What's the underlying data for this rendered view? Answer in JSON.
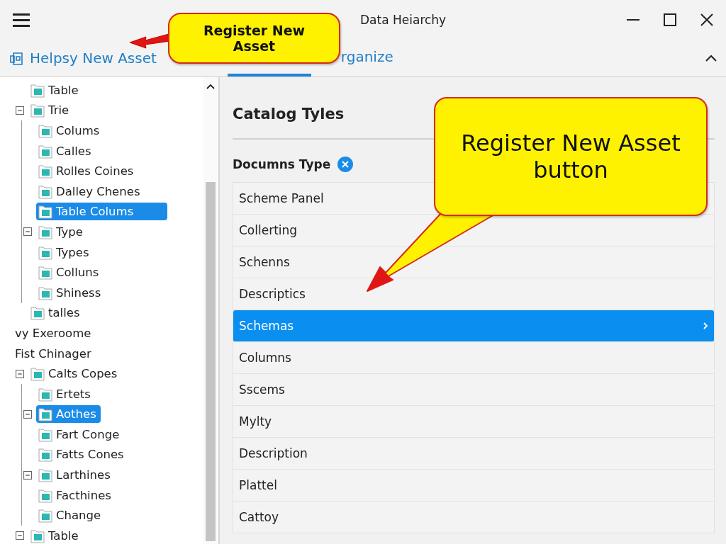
{
  "window": {
    "title": "Data Heiarchy"
  },
  "toolbar": {
    "action": "Helpsy New Asset",
    "tabs": [
      {
        "selected": true
      },
      {
        "label": "rganize",
        "selected": false
      }
    ]
  },
  "tree": [
    {
      "label": "Table",
      "kind": "folder",
      "expandable": false,
      "selected": false
    },
    {
      "label": "Trie",
      "kind": "folder",
      "expandable": true,
      "selected": false,
      "children": [
        {
          "label": "Colums",
          "kind": "folder",
          "expandable": false,
          "selected": false
        },
        {
          "label": "Calles",
          "kind": "folder",
          "expandable": false,
          "selected": false
        },
        {
          "label": "Rolles Coines",
          "kind": "folder",
          "expandable": false,
          "selected": false
        },
        {
          "label": "Dalley Chenes",
          "kind": "folder",
          "expandable": false,
          "selected": false
        },
        {
          "label": "Table Colums",
          "kind": "folder",
          "expandable": false,
          "selected": true
        },
        {
          "label": "Type",
          "kind": "folder",
          "expandable": true,
          "selected": false
        },
        {
          "label": "Types",
          "kind": "folder",
          "expandable": false,
          "selected": false
        },
        {
          "label": "Colluns",
          "kind": "folder",
          "expandable": false,
          "selected": false
        },
        {
          "label": "Shiness",
          "kind": "folder",
          "expandable": false,
          "selected": false
        }
      ]
    },
    {
      "label": "talles",
      "kind": "folder",
      "expandable": false,
      "selected": false
    },
    {
      "label": "vy Exeroome",
      "kind": "group",
      "expandable": false,
      "selected": false
    },
    {
      "label": "Fist Chinager",
      "kind": "group",
      "expandable": false,
      "selected": false
    },
    {
      "label": "Calts Copes",
      "kind": "folder",
      "expandable": true,
      "selected": false,
      "children": [
        {
          "label": "Ertets",
          "kind": "folder",
          "expandable": false,
          "selected": false
        },
        {
          "label": "Aothes",
          "kind": "folder",
          "expandable": true,
          "selected": true
        },
        {
          "label": "Fart Conge",
          "kind": "folder",
          "expandable": false,
          "selected": false
        },
        {
          "label": "Fatts Cones",
          "kind": "folder",
          "expandable": false,
          "selected": false
        },
        {
          "label": "Larthines",
          "kind": "folder",
          "expandable": true,
          "selected": false
        },
        {
          "label": "Facthines",
          "kind": "folder",
          "expandable": false,
          "selected": false
        },
        {
          "label": "Change",
          "kind": "folder",
          "expandable": false,
          "selected": false
        }
      ]
    },
    {
      "label": "Table",
      "kind": "folder",
      "expandable": true,
      "selected": false
    }
  ],
  "catalog": {
    "heading": "Catalog Tyles",
    "filter": "Documns Type",
    "items": [
      {
        "label": "Scheme Panel",
        "selected": false
      },
      {
        "label": "Collerting",
        "selected": false
      },
      {
        "label": "Schenns",
        "selected": false
      },
      {
        "label": "Descriptics",
        "selected": false
      },
      {
        "label": "Schemas",
        "selected": true
      },
      {
        "label": "Columns",
        "selected": false
      },
      {
        "label": "Sscems",
        "selected": false
      },
      {
        "label": "Mylty",
        "selected": false
      },
      {
        "label": "Description",
        "selected": false
      },
      {
        "label": "Plattel",
        "selected": false
      },
      {
        "label": "Cattoy",
        "selected": false
      }
    ]
  },
  "callouts": [
    {
      "text": "Register New Asset"
    },
    {
      "text": "Register New Asset button"
    }
  ]
}
